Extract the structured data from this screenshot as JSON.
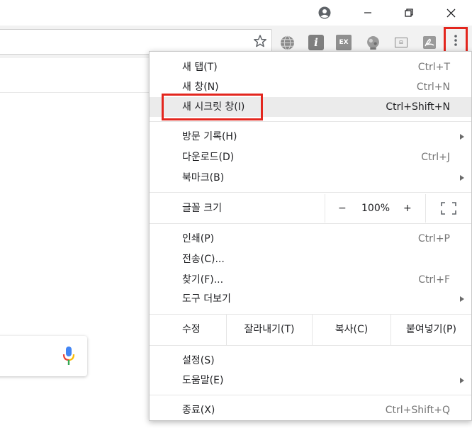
{
  "menu": {
    "items": [
      {
        "label": "새 탭(T)",
        "shortcut": "Ctrl+T"
      },
      {
        "label": "새 창(N)",
        "shortcut": "Ctrl+N"
      },
      {
        "label": "새 시크릿 창(I)",
        "shortcut": "Ctrl+Shift+N"
      },
      {
        "label": "방문 기록(H)",
        "shortcut": ""
      },
      {
        "label": "다운로드(D)",
        "shortcut": "Ctrl+J"
      },
      {
        "label": "북마크(B)",
        "shortcut": ""
      },
      {
        "label": "인쇄(P)",
        "shortcut": "Ctrl+P"
      },
      {
        "label": "전송(C)...",
        "shortcut": ""
      },
      {
        "label": "찾기(F)...",
        "shortcut": "Ctrl+F"
      },
      {
        "label": "도구 더보기",
        "shortcut": ""
      },
      {
        "label": "설정(S)",
        "shortcut": ""
      },
      {
        "label": "도움말(E)",
        "shortcut": ""
      },
      {
        "label": "종료(X)",
        "shortcut": "Ctrl+Shift+Q"
      }
    ],
    "zoom": {
      "label": "글꼴 크기",
      "minus": "−",
      "value": "100%",
      "plus": "+"
    },
    "edit": {
      "label": "수정",
      "cut": "잘라내기(T)",
      "copy": "복사(C)",
      "paste": "붙여넣기(P)"
    }
  },
  "colors": {
    "highlight": "#e3261e",
    "menu_hover": "#ebebeb"
  },
  "extensions": [
    "globe-icon",
    "info-icon",
    "ex-icon",
    "network-icon",
    "card-icon",
    "pdf-icon"
  ],
  "ext_labels": {
    "info": "i",
    "ex": "EX",
    "card": "⊟"
  }
}
